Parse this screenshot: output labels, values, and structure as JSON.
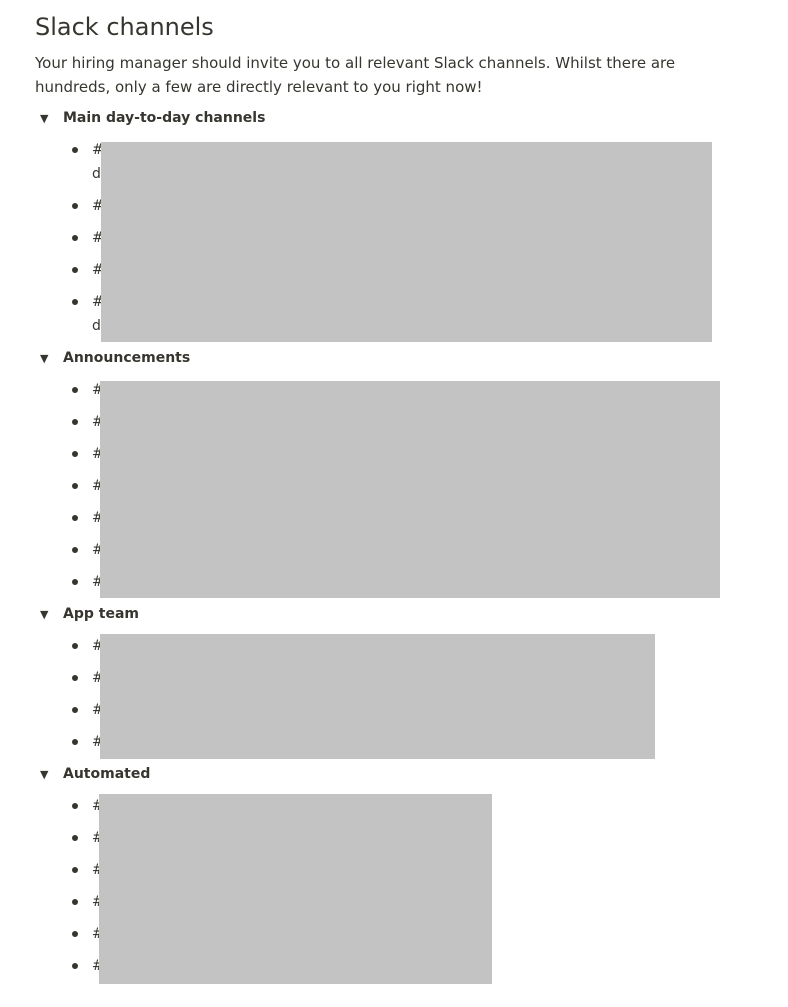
{
  "page": {
    "title": "Slack channels",
    "intro": "Your hiring manager should invite you to all relevant Slack channels. Whilst there are hundreds, only a few are directly relevant to you right now!"
  },
  "sections": [
    {
      "title": "Main day-to-day channels",
      "expanded": true,
      "arrow": "▼",
      "items": [
        "#",
        "#",
        "#",
        "#",
        "#"
      ],
      "visible_wrap_chars": [
        "d",
        "d"
      ]
    },
    {
      "title": "Announcements",
      "expanded": true,
      "arrow": "▼",
      "items": [
        "#",
        "#",
        "#",
        "#",
        "#",
        "#",
        "#"
      ]
    },
    {
      "title": "App team",
      "expanded": true,
      "arrow": "▼",
      "items": [
        "#",
        "#",
        "#",
        "#"
      ]
    },
    {
      "title": "Automated",
      "expanded": true,
      "arrow": "▼",
      "items": [
        "#",
        "#",
        "#",
        "#",
        "#",
        "#"
      ]
    }
  ],
  "colors": {
    "text": "#37352f",
    "redaction": "#c3c3c3",
    "background": "#ffffff"
  }
}
